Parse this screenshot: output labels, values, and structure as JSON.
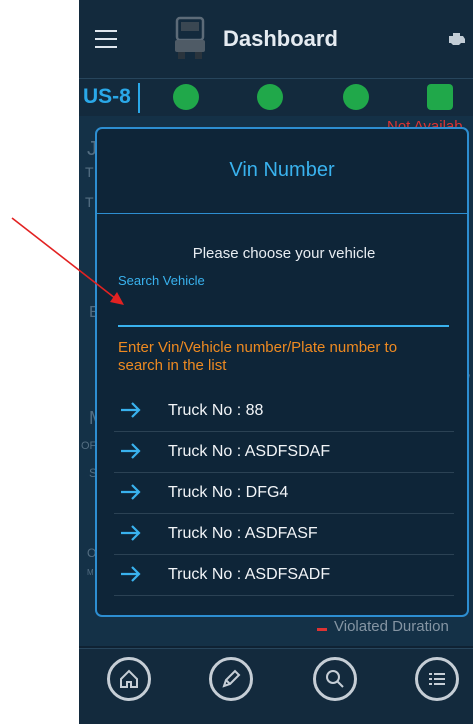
{
  "app": {
    "title": "Dashboard",
    "us_label": "US-8"
  },
  "background": {
    "status_red": "Not Availab",
    "violated": "Violated Duration",
    "letters": [
      "J",
      "T",
      "T",
      "E",
      "M",
      "OF",
      "S",
      "O",
      "M",
      "/"
    ]
  },
  "dialog": {
    "title": "Vin Number",
    "prompt": "Please choose your vehicle",
    "search_label": "Search Vehicle",
    "search_value": "",
    "hint": "Enter Vin/Vehicle number/Plate number to search in the list",
    "items": [
      {
        "label": "Truck No : 88"
      },
      {
        "label": "Truck No : ASDFSDAF"
      },
      {
        "label": "Truck No : DFG4"
      },
      {
        "label": "Truck No : ASDFASF"
      },
      {
        "label": "Truck No : ASDFSADF"
      }
    ]
  },
  "bottom_nav": [
    "home-icon",
    "pencil-icon",
    "search-icon",
    "list-menu-icon"
  ],
  "colors": {
    "accent": "#39b2ee",
    "hint": "#ee8a21",
    "green": "#20a84a",
    "annotation_arrow": "#e22222"
  }
}
